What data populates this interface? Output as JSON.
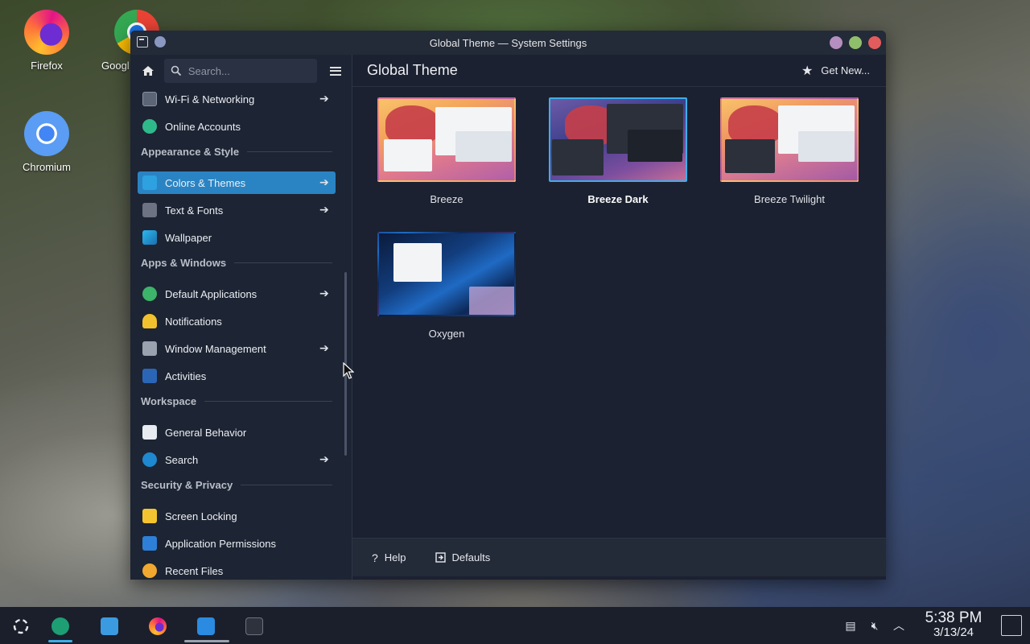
{
  "desktop": {
    "icons": [
      {
        "label": "Firefox"
      },
      {
        "label": "Googl"
      },
      {
        "label": "Chromium"
      }
    ]
  },
  "window": {
    "title": "Global Theme — System Settings"
  },
  "sidebar": {
    "search_placeholder": "Search...",
    "items": [
      {
        "label": "Wi-Fi & Networking",
        "has_arrow": true
      },
      {
        "label": "Online Accounts",
        "has_arrow": false
      },
      {
        "label": "Colors & Themes",
        "has_arrow": true,
        "active": true
      },
      {
        "label": "Text & Fonts",
        "has_arrow": true
      },
      {
        "label": "Wallpaper",
        "has_arrow": false
      },
      {
        "label": "Default Applications",
        "has_arrow": true
      },
      {
        "label": "Notifications",
        "has_arrow": false
      },
      {
        "label": "Window Management",
        "has_arrow": true
      },
      {
        "label": "Activities",
        "has_arrow": false
      },
      {
        "label": "General Behavior",
        "has_arrow": false
      },
      {
        "label": "Search",
        "has_arrow": true
      },
      {
        "label": "Screen Locking",
        "has_arrow": false
      },
      {
        "label": "Application Permissions",
        "has_arrow": false
      },
      {
        "label": "Recent Files",
        "has_arrow": false
      }
    ],
    "categories": [
      {
        "label": "Appearance & Style"
      },
      {
        "label": "Apps & Windows"
      },
      {
        "label": "Workspace"
      },
      {
        "label": "Security & Privacy"
      }
    ]
  },
  "main": {
    "title": "Global Theme",
    "get_new_label": "Get New...",
    "themes": [
      {
        "name": "Breeze",
        "selected": false
      },
      {
        "name": "Breeze Dark",
        "selected": true
      },
      {
        "name": "Breeze Twilight",
        "selected": false
      },
      {
        "name": "Oxygen",
        "selected": false
      }
    ],
    "footer": {
      "help_label": "Help",
      "defaults_label": "Defaults"
    }
  },
  "taskbar": {
    "time": "5:38 PM",
    "date": "3/13/24"
  },
  "colors": {
    "accent": "#3daee9",
    "active_item": "#2a84c3",
    "window_bg": "#1b2130"
  }
}
